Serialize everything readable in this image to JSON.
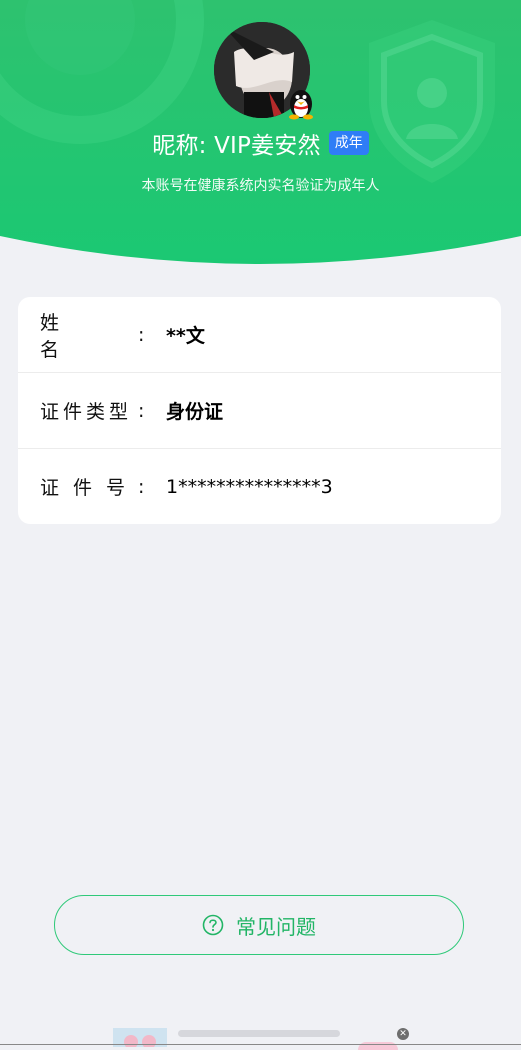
{
  "header": {
    "nickname": "昵称: VIP姜安然",
    "adult_badge": "成年",
    "verify_note": "本账号在健康系统内实名验证为成年人"
  },
  "info": {
    "rows": [
      {
        "label": "姓名",
        "value": "**文"
      },
      {
        "label": "证件类型",
        "value": "身份证"
      },
      {
        "label": "证件号",
        "value": "1***************3"
      }
    ]
  },
  "faq": {
    "label": "常见问题"
  },
  "colors": {
    "header_green_top": "#2cc06d",
    "header_green_bottom": "#1dc872",
    "badge_blue": "#2f7df6",
    "faq_green": "#22b566",
    "page_bg": "#f0f1f5"
  },
  "icons": [
    "shield-icon",
    "qq-penguin-icon",
    "question-circle-icon",
    "close-icon"
  ]
}
